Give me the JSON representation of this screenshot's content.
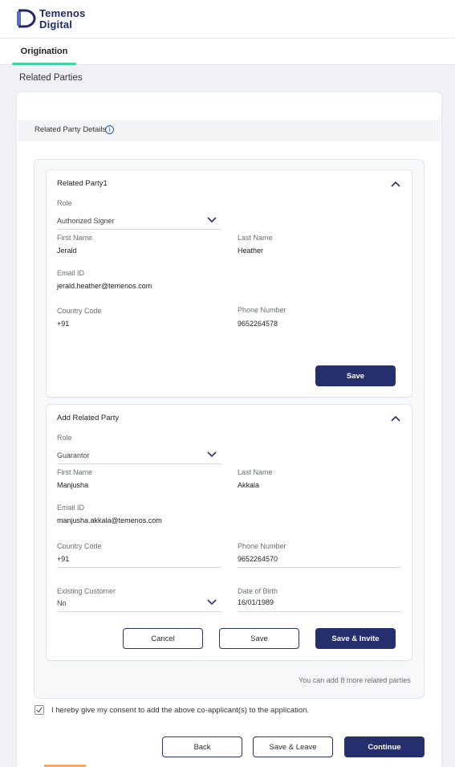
{
  "brand": {
    "line1": "Temenos",
    "line2": "Digital",
    "accent_color": "#1f2a6b"
  },
  "tabs": [
    {
      "label": "Origination",
      "active": true
    }
  ],
  "page": {
    "section_title": "Related Parties",
    "details_label": "Related Party Details"
  },
  "party1": {
    "title": "Related Party1",
    "role_label": "Role",
    "role_value": "Authorized Signer",
    "first_name_label": "First Name",
    "first_name": "Jerald",
    "last_name_label": "Last Name",
    "last_name": "Heather",
    "email_label": "Email ID",
    "email": "jerald.heather@temenos.com",
    "country_code_label": "Country Code",
    "country_code": "+91",
    "phone_label": "Phone Number",
    "phone": "9652264578",
    "save_label": "Save"
  },
  "party2": {
    "title": "Add Related Party",
    "role_label": "Role",
    "role_value": "Guarantor",
    "first_name_label": "First Name",
    "first_name": "Manjusha",
    "last_name_label": "Last Name",
    "last_name": "Akkala",
    "email_label": "Email ID",
    "email": "manjusha.akkala@temenos.com",
    "country_code_label": "Country Code",
    "country_code": "+91",
    "phone_label": "Phone Number",
    "phone": "9652264570",
    "existing_customer_label": "Existing Customer",
    "existing_customer_value": "No",
    "dob_label": "Date of Birth",
    "dob": "16/01/1989",
    "cancel_label": "Cancel",
    "save_label": "Save",
    "save_invite_label": "Save & Invite"
  },
  "hint": "You can add 8 more related parties",
  "consent": {
    "text": "I hereby give my consent to add the above co-applicant(s) to the application.",
    "checked": true
  },
  "footer": {
    "back_label": "Back",
    "save_leave_label": "Save & Leave",
    "continue_label": "Continue"
  },
  "icons": {
    "info": "info-icon",
    "chevron_up": "chevron-up-icon",
    "chevron_down": "chevron-down-icon",
    "check": "check-icon",
    "logo": "temenos-logo-icon"
  },
  "colors": {
    "primary": "#262f6e",
    "tab_accent": "#3fd3a8",
    "page_bg": "#eff1f4"
  }
}
